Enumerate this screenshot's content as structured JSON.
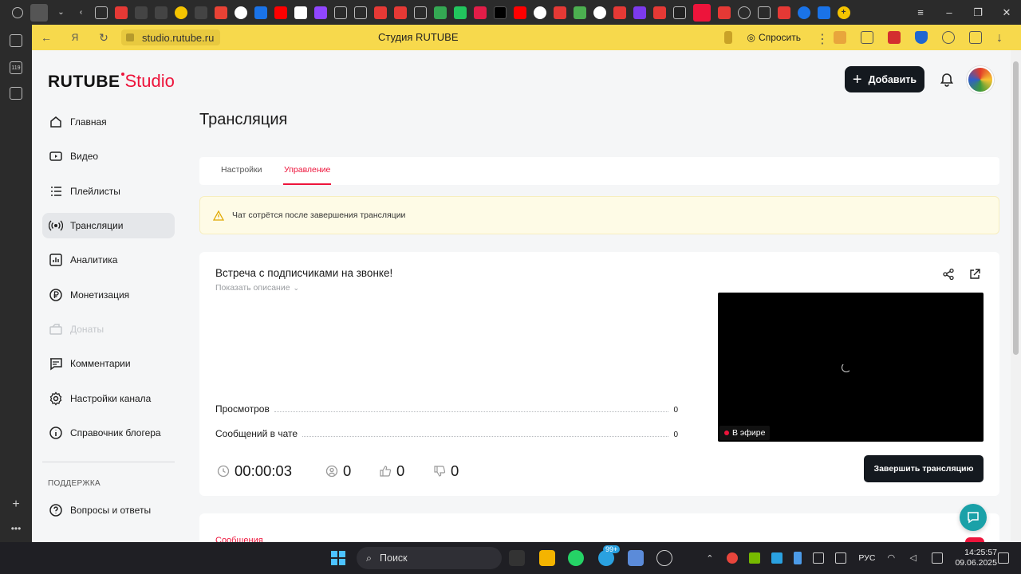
{
  "browser": {
    "url": "studio.rutube.ru",
    "page_title": "Студия RUTUBE",
    "ask_label": "Спросить",
    "sidebar_badge": "119"
  },
  "header": {
    "logo_main": "RUTUBE",
    "logo_sub": "Studio",
    "add_label": "Добавить"
  },
  "sidebar": {
    "items": [
      {
        "label": "Главная",
        "icon": "home-icon"
      },
      {
        "label": "Видео",
        "icon": "video-icon"
      },
      {
        "label": "Плейлисты",
        "icon": "playlist-icon"
      },
      {
        "label": "Трансляции",
        "icon": "broadcast-icon"
      },
      {
        "label": "Аналитика",
        "icon": "analytics-icon"
      },
      {
        "label": "Монетизация",
        "icon": "monetization-icon"
      },
      {
        "label": "Донаты",
        "icon": "donations-icon"
      },
      {
        "label": "Комментарии",
        "icon": "comments-icon"
      },
      {
        "label": "Настройки канала",
        "icon": "gear-icon"
      },
      {
        "label": "Справочник блогера",
        "icon": "info-icon"
      }
    ],
    "support_title": "ПОДДЕРЖКА",
    "support_items": [
      {
        "label": "Вопросы и ответы",
        "icon": "question-icon"
      }
    ]
  },
  "main": {
    "title": "Трансляция",
    "tabs": [
      {
        "label": "Настройки"
      },
      {
        "label": "Управление"
      }
    ],
    "warning": "Чат сотрётся после завершения трансляции",
    "stream": {
      "title": "Встреча с подписчиками на звонке!",
      "show_description": "Показать описание",
      "stats": [
        {
          "label": "Просмотров",
          "value": "0"
        },
        {
          "label": "Сообщений в чате",
          "value": "0"
        }
      ],
      "live_badge": "В эфире",
      "timer": "00:00:03",
      "viewers": "0",
      "likes": "0",
      "dislikes": "0",
      "end_label": "Завершить трансляцию"
    },
    "chat_peek": "Сообщения"
  },
  "taskbar": {
    "search": "Поиск",
    "badge": "99+",
    "lang": "РУС",
    "time": "14:25:57",
    "date": "09.06.2025"
  },
  "colors": {
    "accent": "#ed143b",
    "address_bar": "#f7d94c",
    "dark_button": "#14191f",
    "help_fab": "#1aa1a8"
  }
}
